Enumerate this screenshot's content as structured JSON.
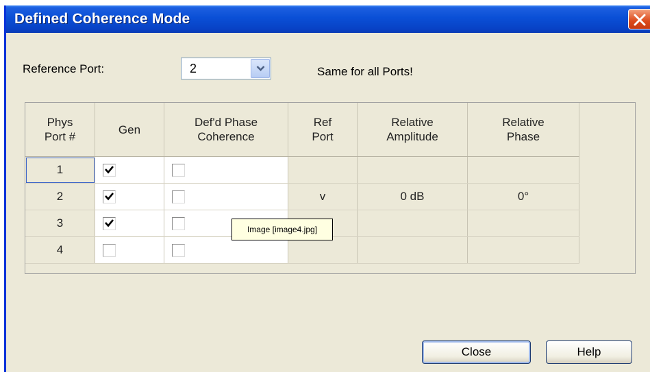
{
  "window": {
    "title": "Defined Coherence Mode"
  },
  "reference": {
    "label": "Reference Port:",
    "selected": "2",
    "note": "Same for all Ports!"
  },
  "table": {
    "headers": [
      [
        "Phys",
        "Port #"
      ],
      [
        "Gen"
      ],
      [
        "Def'd Phase",
        "Coherence"
      ],
      [
        "Ref",
        "Port"
      ],
      [
        "Relative",
        "Amplitude"
      ],
      [
        "Relative",
        "Phase"
      ]
    ],
    "rows": [
      {
        "port": "1",
        "gen": true,
        "coherence": false,
        "ref": "",
        "amplitude": "",
        "phase": ""
      },
      {
        "port": "2",
        "gen": true,
        "coherence": false,
        "ref": "v",
        "amplitude": "0 dB",
        "phase": "0°"
      },
      {
        "port": "3",
        "gen": true,
        "coherence": false,
        "ref": "",
        "amplitude": "",
        "phase": ""
      },
      {
        "port": "4",
        "gen": false,
        "coherence": false,
        "ref": "",
        "amplitude": "",
        "phase": ""
      }
    ]
  },
  "tooltip": "Image [image4.jpg]",
  "buttons": {
    "close": "Close",
    "help": "Help"
  },
  "colors": {
    "titlebar": "#0a4fd6",
    "dialog_bg": "#ece9d8",
    "close_x": "#dc4a1c"
  }
}
